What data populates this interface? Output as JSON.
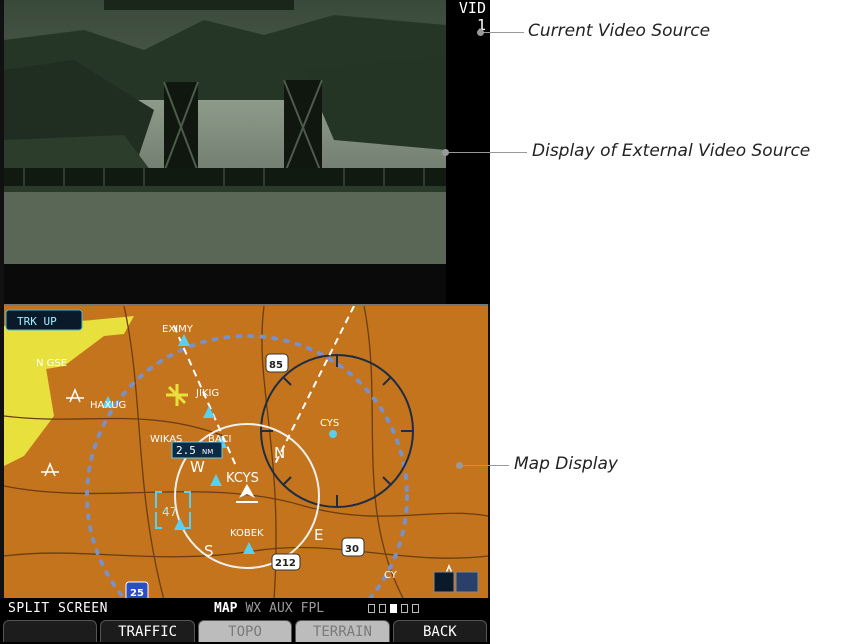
{
  "video": {
    "vid_label": "VID",
    "vid_number": "1"
  },
  "map": {
    "orientation_label": "TRK UP",
    "range_label": "2.5",
    "range_unit": "NM",
    "waypoints": [
      "EXIMY",
      "N GSE",
      "HAXUG",
      "JIKIG",
      "WIKAS",
      "BACI",
      "CYS",
      "KCYS",
      "KOBEK"
    ],
    "compass": [
      "W",
      "N",
      "E",
      "S"
    ],
    "highways": [
      "85",
      "30",
      "212",
      "25"
    ],
    "small_labels": [
      "47",
      "CY"
    ],
    "colors": {
      "terrain": "#c4741c",
      "water_yellow": "#e8e03c",
      "range_ring": "#7a90c8",
      "track_line": "#ffffff",
      "waypoint": "#5ad0f0"
    }
  },
  "status": {
    "split_label": "SPLIT SCREEN",
    "pages": [
      {
        "label": "MAP",
        "active": true
      },
      {
        "label": "WX",
        "active": false
      },
      {
        "label": "AUX",
        "active": false
      },
      {
        "label": "FPL",
        "active": false
      }
    ],
    "page_dots": [
      false,
      false,
      true,
      false,
      false
    ]
  },
  "softkeys": [
    {
      "label": "",
      "selected": false
    },
    {
      "label": "TRAFFIC",
      "selected": false
    },
    {
      "label": "TOPO",
      "selected": true
    },
    {
      "label": "TERRAIN",
      "selected": true
    },
    {
      "label": "BACK",
      "selected": false
    }
  ],
  "callouts": {
    "current_video": "Current Video Source",
    "external_video": "Display of External Video Source",
    "map_display": "Map Display"
  }
}
